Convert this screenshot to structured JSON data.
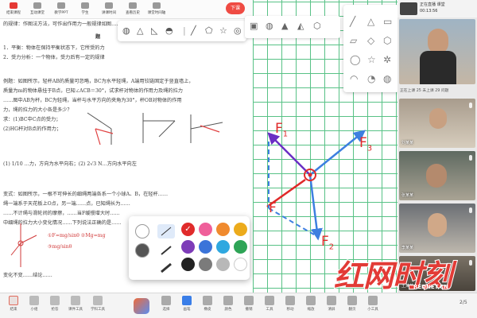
{
  "topbar": {
    "items": [
      "结束课程",
      "互动课堂",
      "教学PPT",
      "学生",
      "讲课时间",
      "查看历史",
      "课堂时间轴"
    ],
    "cast_label": "下课"
  },
  "document": {
    "lines": [
      "的规律：作图法方法，可作出作用力一般规律如图……",
      "1．平衡：物体在保持平衡状态下，它所受的力",
      "2．受力分析：一个物体，受力后有一定的规律",
      "例题：如图所示，轻杆AB的质量可忽略，BC为水平轻绳，A端用铰链固定于竖直墙上，",
      "质量为m的物体悬挂于B点，已知∠ACB＝30°，试求杆对物体的作用力及绳的拉力",
      "……图中AB为杆，BC为轻绳，当杆与水平方向的夹角为30°，杆OB对物体的作用",
      "力，绳的拉力的大小各是多少？",
      "求：(1)BC中C点的受力；",
      "(2)HG杆对B点的作用力；",
      "(1) 1/10 …力，方向为水平向右；(2) 2√3 N…方向水平向左",
      "变式：如图所示，一根不可伸长的细绳两端各系一个小球A、B，在轻杆……",
      "绳一端系于天花板上O点，另一端……点，已知绳长为……",
      "……不计绳与滑轮间的摩擦，……当F缓慢增大时……",
      "中细绳的拉力大小变化情况……下列说法正确的是……",
      "①F=mg/sinθ  ②Mg=mg",
      "③mg/sinθ",
      "变化不变……结论……"
    ],
    "heading": "题",
    "answer_prefix": "(1)",
    "answer_value": "1/10"
  },
  "board": {
    "labels": {
      "f1": "F",
      "f1_sub": "1",
      "f3": "F",
      "f3_sub": "3",
      "f": "F",
      "f2": "F",
      "f2_sub": "2"
    }
  },
  "pen_popup": {
    "swatches": [
      "#e02b2b",
      "#ef5f9a",
      "#f08a2e",
      "#ecab1c",
      "#7d3cb8",
      "#3b74d9",
      "#2fa8e0",
      "#2ea456",
      "#222222",
      "#7b7b7b",
      "#b8b8b8",
      "#ffffff"
    ],
    "selected_color": "#e02b2b"
  },
  "bottombar": {
    "left_items": [
      "结束",
      "小组",
      "抢答",
      "课件工具",
      "学科工具"
    ],
    "center_items": [
      "选择",
      "画笔",
      "橡皮",
      "颜色",
      "撤销",
      "工具",
      "移动",
      "缩放",
      "清屏",
      "翻页",
      "小工具"
    ],
    "page": "2/5"
  },
  "videos": {
    "header_title": "正在直播 课堂",
    "header_time": "00:13:56",
    "header_status": "正在上课 25   未上课 29   问题",
    "tiles": [
      "刘某某",
      "张某某",
      "李某某",
      "王某某",
      "赵某某"
    ]
  },
  "watermark": {
    "text": "红网时刻",
    "sub": "REDNET.CN"
  }
}
